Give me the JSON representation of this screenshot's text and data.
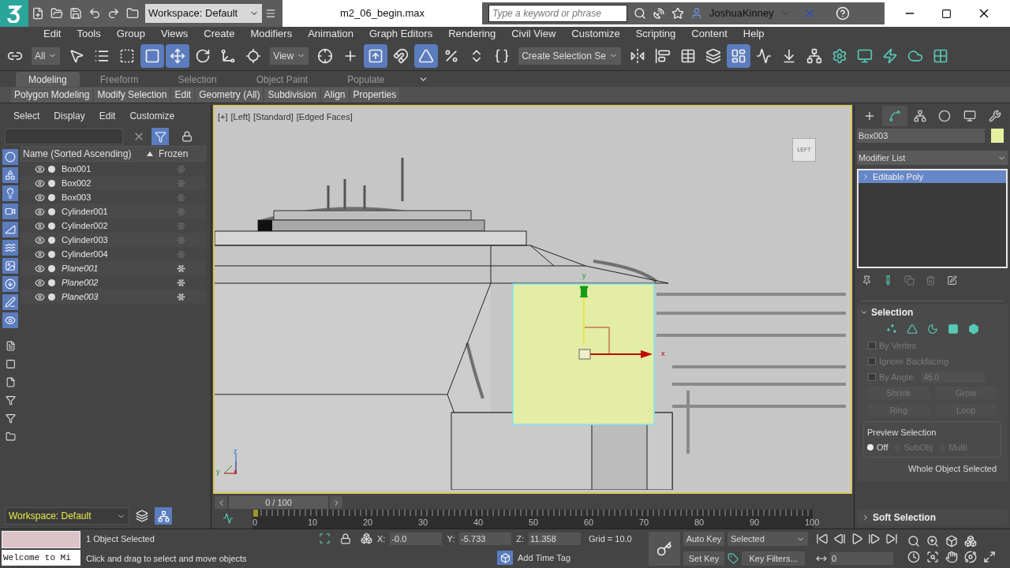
{
  "title_bar": {
    "workspace": "Workspace: Default",
    "file_name": "m2_06_begin.max",
    "search": {
      "placeholder": "Type a keyword or phrase"
    },
    "user": "JoshuaKinney"
  },
  "menu": [
    "Edit",
    "Tools",
    "Group",
    "Views",
    "Create",
    "Modifiers",
    "Animation",
    "Graph Editors",
    "Rendering",
    "Civil View",
    "Customize",
    "Scripting",
    "Content",
    "Help"
  ],
  "main_toolbar": [
    {
      "kind": "button",
      "selected": false
    },
    {
      "kind": "dropdown",
      "value": "All"
    },
    {
      "kind": "button",
      "selected": false
    },
    {
      "kind": "button",
      "selected": false
    },
    {
      "kind": "button",
      "selected": false
    },
    {
      "kind": "button",
      "selected": true
    },
    {
      "kind": "button",
      "selected": true
    },
    {
      "kind": "button",
      "selected": false
    },
    {
      "kind": "button",
      "selected": false
    },
    {
      "kind": "button",
      "selected": false
    },
    {
      "kind": "dropdown",
      "value": "View"
    },
    {
      "kind": "button",
      "selected": false
    },
    {
      "kind": "button",
      "selected": false
    },
    {
      "kind": "button",
      "selected": true
    },
    {
      "kind": "button",
      "selected": false
    },
    {
      "kind": "button",
      "selected": true
    },
    {
      "kind": "button",
      "selected": false
    },
    {
      "kind": "button",
      "selected": false
    },
    {
      "kind": "button",
      "selected": false
    },
    {
      "kind": "dropdown",
      "value": "Create Selection Se"
    },
    {
      "kind": "button",
      "selected": false
    },
    {
      "kind": "button",
      "selected": false
    },
    {
      "kind": "button",
      "selected": false
    },
    {
      "kind": "button",
      "selected": false
    },
    {
      "kind": "button",
      "selected": true
    },
    {
      "kind": "button",
      "selected": false
    },
    {
      "kind": "button",
      "selected": false
    },
    {
      "kind": "button",
      "selected": false
    },
    {
      "kind": "button",
      "selected": false
    },
    {
      "kind": "button",
      "selected": false
    },
    {
      "kind": "button",
      "selected": false
    },
    {
      "kind": "button",
      "selected": false
    },
    {
      "kind": "button",
      "selected": false
    }
  ],
  "ribbon": {
    "tabs": [
      {
        "label": "Modeling",
        "selected": true
      },
      {
        "label": "Freeform",
        "selected": false
      },
      {
        "label": "Selection",
        "selected": false
      },
      {
        "label": "Object Paint",
        "selected": false
      },
      {
        "label": "Populate",
        "selected": false
      }
    ],
    "panels": [
      "Polygon Modeling",
      "Modify Selection",
      "Edit",
      "Geometry (All)",
      "Subdivision",
      "Align",
      "Properties"
    ]
  },
  "scene_explorer": {
    "menu": [
      "Select",
      "Display",
      "Edit",
      "Customize"
    ],
    "filters": [
      {
        "on": true
      },
      {
        "on": true
      },
      {
        "on": true
      },
      {
        "on": true
      },
      {
        "on": true
      },
      {
        "on": true
      },
      {
        "on": true
      },
      {
        "on": true
      },
      {
        "on": true
      },
      {
        "on": true
      }
    ],
    "columns": [
      "Name (Sorted Ascending)",
      "Frozen"
    ],
    "rows": [
      {
        "name": "Box001",
        "frozen": false
      },
      {
        "name": "Box002",
        "frozen": false
      },
      {
        "name": "Box003",
        "frozen": false
      },
      {
        "name": "Cylinder001",
        "frozen": false
      },
      {
        "name": "Cylinder002",
        "frozen": false
      },
      {
        "name": "Cylinder003",
        "frozen": false
      },
      {
        "name": "Cylinder004",
        "frozen": false
      },
      {
        "name": "Plane001",
        "frozen": true
      },
      {
        "name": "Plane002",
        "frozen": true
      },
      {
        "name": "Plane003",
        "frozen": true
      }
    ],
    "workspace": "Workspace: Default"
  },
  "viewport": {
    "labels": [
      "[+]",
      "[Left]",
      "[Standard]",
      "[Edged Faces]"
    ],
    "viewcube": "LEFT",
    "gizmo_axes": [
      "y",
      "x"
    ],
    "tripod_axes": [
      "z",
      "y",
      "x"
    ]
  },
  "command_panel": {
    "tabs": [
      {
        "selected": false
      },
      {
        "selected": true
      },
      {
        "selected": false
      },
      {
        "selected": false
      },
      {
        "selected": false
      },
      {
        "selected": false
      }
    ],
    "object_name": "Box003",
    "modifier_list": "Modifier List",
    "stack": [
      {
        "label": "Editable Poly",
        "selected": true
      }
    ],
    "selection_rollout": {
      "title": "Selection",
      "levels": [
        {
          "selected": false
        },
        {
          "selected": false
        },
        {
          "selected": false
        },
        {
          "selected": false
        },
        {
          "selected": false
        }
      ],
      "checkboxes": [
        {
          "label": "By Vertex",
          "checked": false,
          "disabled": true
        },
        {
          "label": "Ignore Backfacing",
          "checked": false,
          "disabled": true
        },
        {
          "label": "By Angle:",
          "checked": false,
          "disabled": true
        }
      ],
      "angle": "45.0",
      "buttons": [
        "Shrink",
        "Grow",
        "Ring",
        "Loop"
      ],
      "preview": {
        "title": "Preview Selection",
        "options": [
          {
            "label": "Off",
            "selected": true,
            "disabled": false
          },
          {
            "label": "SubObj",
            "selected": false,
            "disabled": true
          },
          {
            "label": "Multi",
            "selected": false,
            "disabled": true
          }
        ]
      },
      "status": "Whole Object Selected"
    },
    "soft_selection": {
      "title": "Soft Selection",
      "expanded": false
    }
  },
  "timeline": {
    "slider": "0 / 100",
    "level": 0,
    "ruler_labels": [
      "0",
      "10",
      "20",
      "30",
      "40",
      "50",
      "60",
      "70",
      "80",
      "90",
      "100"
    ]
  },
  "status_bar": {
    "listener_output": "Welcome to Mi",
    "selection": "1 Object Selected",
    "prompt": "Click and drag to select and move objects",
    "coords": [
      {
        "axis": "X:",
        "value": "-0.0"
      },
      {
        "axis": "Y:",
        "value": "-5.733"
      },
      {
        "axis": "Z:",
        "value": "11.358"
      }
    ],
    "grid": "Grid = 10.0",
    "time_tag": "Add Time Tag",
    "auto_key": "Auto Key",
    "set_key": "Set Key",
    "key_mode": "Selected",
    "key_filters": "Key Filters...",
    "frame": "0"
  }
}
